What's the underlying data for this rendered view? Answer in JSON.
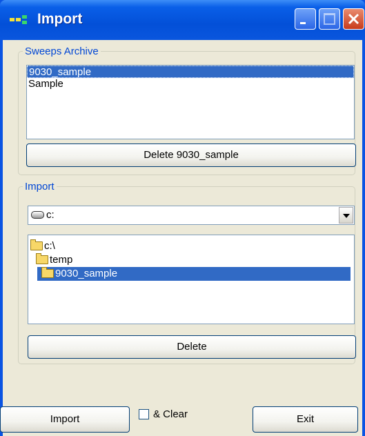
{
  "window": {
    "title": "Import",
    "buttons": [
      "minimize",
      "maximize",
      "close"
    ]
  },
  "sweeps_archive": {
    "legend": "Sweeps Archive",
    "items": [
      {
        "label": "9030_sample",
        "selected": true
      },
      {
        "label": "Sample",
        "selected": false
      }
    ],
    "delete_button": "Delete 9030_sample"
  },
  "import_group": {
    "legend": "Import",
    "drive_combo": {
      "value": "c:"
    },
    "tree": [
      {
        "label": "c:\\",
        "indent": 0,
        "selected": false,
        "icon": "open-folder-icon"
      },
      {
        "label": "temp",
        "indent": 1,
        "selected": false,
        "icon": "open-folder-icon"
      },
      {
        "label": "9030_sample",
        "indent": 2,
        "selected": true,
        "icon": "folder-icon"
      }
    ],
    "delete_button": "Delete"
  },
  "footer": {
    "import_button": "Import",
    "clear_checkbox": {
      "label": "& Clear",
      "checked": false
    },
    "exit_button": "Exit"
  },
  "colors": {
    "titlebar": "#0350d8",
    "face": "#ece9d8",
    "selection": "#316ac5",
    "legend_text": "#0046d5"
  }
}
